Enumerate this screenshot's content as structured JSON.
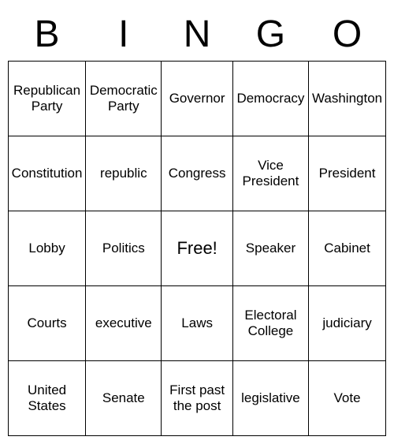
{
  "header": {
    "letters": [
      "B",
      "I",
      "N",
      "G",
      "O"
    ]
  },
  "grid": {
    "rows": [
      [
        "Republican Party",
        "Democratic Party",
        "Governor",
        "Democracy",
        "Washington"
      ],
      [
        "Constitution",
        "republic",
        "Congress",
        "Vice President",
        "President"
      ],
      [
        "Lobby",
        "Politics",
        "Free!",
        "Speaker",
        "Cabinet"
      ],
      [
        "Courts",
        "executive",
        "Laws",
        "Electoral College",
        "judiciary"
      ],
      [
        "United States",
        "Senate",
        "First past the post",
        "legislative",
        "Vote"
      ]
    ]
  }
}
